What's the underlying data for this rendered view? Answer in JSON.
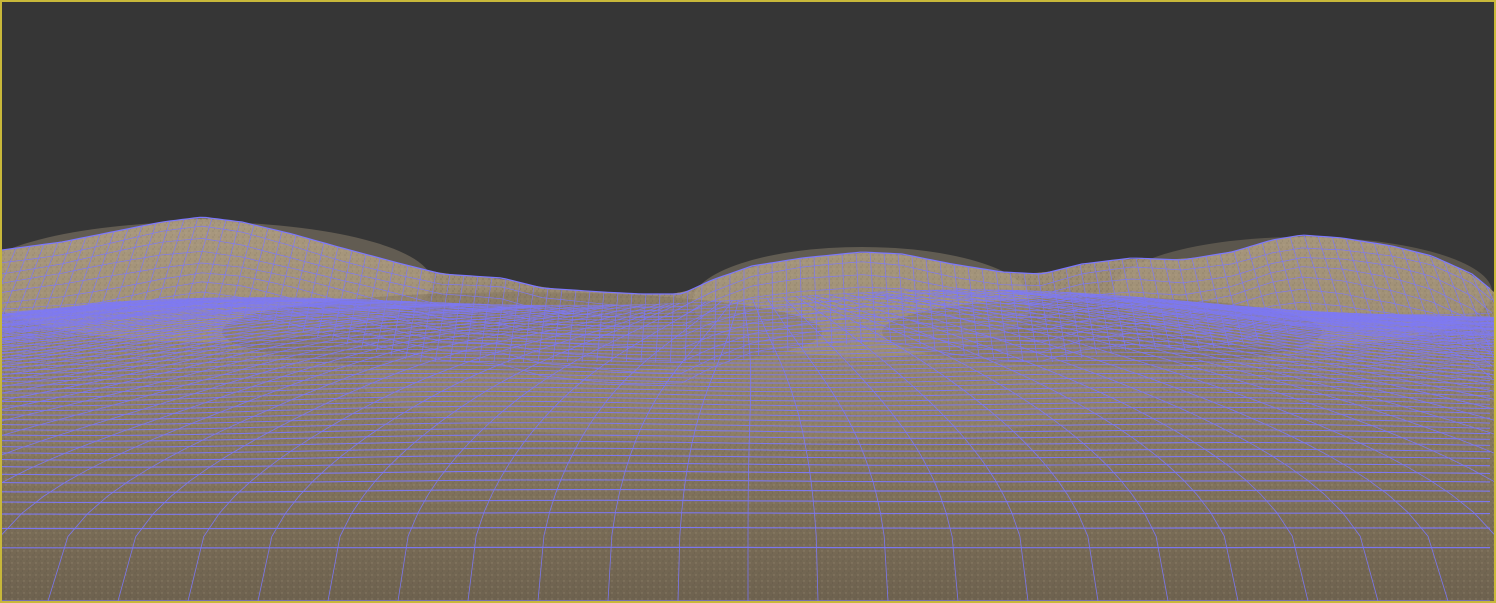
{
  "viewport": {
    "border_color": "#c8b83a",
    "background_color": "#363636",
    "terrain_color": "#8a7b62",
    "terrain_light": "#a3937a",
    "terrain_dark": "#6e624f",
    "wireframe_color": "#7c78ff"
  }
}
